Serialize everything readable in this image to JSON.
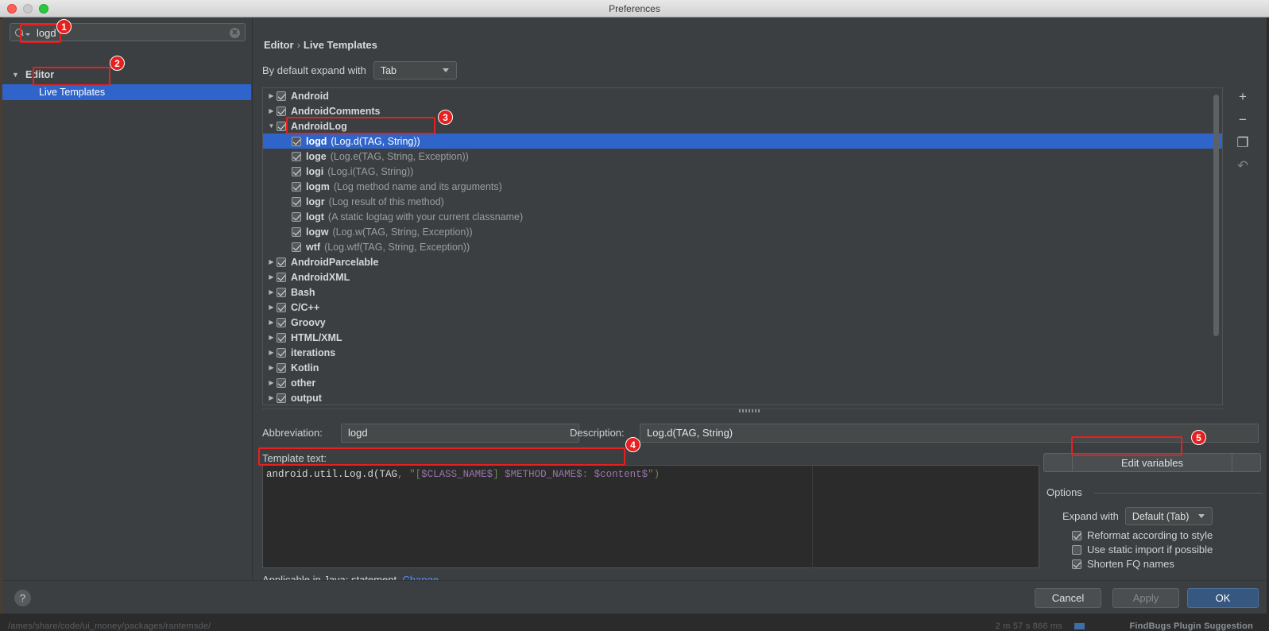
{
  "window": {
    "title": "Preferences",
    "controls": [
      "close",
      "minimize",
      "zoom"
    ]
  },
  "sidebar": {
    "search": {
      "value": "logd",
      "placeholder": ""
    },
    "tree": [
      {
        "label": "Editor",
        "expanded": true,
        "selected": false
      },
      {
        "label": "Live Templates",
        "expanded": false,
        "selected": true
      }
    ]
  },
  "breadcrumb": {
    "root": "Editor",
    "separator": "›",
    "leaf": "Live Templates"
  },
  "expand_with": {
    "label": "By default expand with",
    "value": "Tab"
  },
  "templates": [
    {
      "indent": 0,
      "arrow": "▶",
      "checked": true,
      "name": "Android",
      "desc": "",
      "selected": false
    },
    {
      "indent": 0,
      "arrow": "▶",
      "checked": true,
      "name": "AndroidComments",
      "desc": "",
      "selected": false
    },
    {
      "indent": 0,
      "arrow": "▼",
      "checked": true,
      "name": "AndroidLog",
      "desc": "",
      "selected": false
    },
    {
      "indent": 1,
      "arrow": "",
      "checked": true,
      "name": "logd",
      "desc": "(Log.d(TAG, String))",
      "selected": true
    },
    {
      "indent": 1,
      "arrow": "",
      "checked": true,
      "name": "loge",
      "desc": "(Log.e(TAG, String, Exception))",
      "selected": false
    },
    {
      "indent": 1,
      "arrow": "",
      "checked": true,
      "name": "logi",
      "desc": "(Log.i(TAG, String))",
      "selected": false
    },
    {
      "indent": 1,
      "arrow": "",
      "checked": true,
      "name": "logm",
      "desc": "(Log method name and its arguments)",
      "selected": false
    },
    {
      "indent": 1,
      "arrow": "",
      "checked": true,
      "name": "logr",
      "desc": "(Log result of this method)",
      "selected": false
    },
    {
      "indent": 1,
      "arrow": "",
      "checked": true,
      "name": "logt",
      "desc": "(A static logtag with your current classname)",
      "selected": false
    },
    {
      "indent": 1,
      "arrow": "",
      "checked": true,
      "name": "logw",
      "desc": "(Log.w(TAG, String, Exception))",
      "selected": false
    },
    {
      "indent": 1,
      "arrow": "",
      "checked": true,
      "name": "wtf",
      "desc": "(Log.wtf(TAG, String, Exception))",
      "selected": false
    },
    {
      "indent": 0,
      "arrow": "▶",
      "checked": true,
      "name": "AndroidParcelable",
      "desc": "",
      "selected": false
    },
    {
      "indent": 0,
      "arrow": "▶",
      "checked": true,
      "name": "AndroidXML",
      "desc": "",
      "selected": false
    },
    {
      "indent": 0,
      "arrow": "▶",
      "checked": true,
      "name": "Bash",
      "desc": "",
      "selected": false
    },
    {
      "indent": 0,
      "arrow": "▶",
      "checked": true,
      "name": "C/C++",
      "desc": "",
      "selected": false
    },
    {
      "indent": 0,
      "arrow": "▶",
      "checked": true,
      "name": "Groovy",
      "desc": "",
      "selected": false
    },
    {
      "indent": 0,
      "arrow": "▶",
      "checked": true,
      "name": "HTML/XML",
      "desc": "",
      "selected": false
    },
    {
      "indent": 0,
      "arrow": "▶",
      "checked": true,
      "name": "iterations",
      "desc": "",
      "selected": false
    },
    {
      "indent": 0,
      "arrow": "▶",
      "checked": true,
      "name": "Kotlin",
      "desc": "",
      "selected": false
    },
    {
      "indent": 0,
      "arrow": "▶",
      "checked": true,
      "name": "other",
      "desc": "",
      "selected": false
    },
    {
      "indent": 0,
      "arrow": "▶",
      "checked": true,
      "name": "output",
      "desc": "",
      "selected": false
    }
  ],
  "list_tools": [
    {
      "icon": "plus-icon",
      "glyph": "+",
      "enabled": true
    },
    {
      "icon": "minus-icon",
      "glyph": "−",
      "enabled": true
    },
    {
      "icon": "copy-icon",
      "glyph": "❐",
      "enabled": true
    },
    {
      "icon": "undo-icon",
      "glyph": "↶",
      "enabled": false
    }
  ],
  "fields": {
    "abbreviation_label": "Abbreviation:",
    "abbreviation_value": "logd",
    "description_label": "Description:",
    "description_value": "Log.d(TAG, String)"
  },
  "template_text": {
    "label": "Template text:",
    "segments": [
      {
        "text": "android.util.Log.d(TAG",
        "style": "plain"
      },
      {
        "text": ",",
        "style": "comma"
      },
      {
        "text": " ",
        "style": "plain"
      },
      {
        "text": "\"[",
        "style": "str"
      },
      {
        "text": "$CLASS_NAME$",
        "style": "var"
      },
      {
        "text": "] ",
        "style": "str"
      },
      {
        "text": "$METHOD_NAME$",
        "style": "var"
      },
      {
        "text": ": ",
        "style": "str"
      },
      {
        "text": "$content$",
        "style": "var"
      },
      {
        "text": "\")",
        "style": "str"
      }
    ],
    "full": "android.util.Log.d(TAG, \"[$CLASS_NAME$] $METHOD_NAME$: $content$\")"
  },
  "applicable": {
    "text": "Applicable in Java: statement.",
    "link": "Change"
  },
  "options": {
    "edit_variables_label": "Edit variables",
    "legend": "Options",
    "expand_with_label": "Expand with",
    "expand_with_value": "Default (Tab)",
    "checkboxes": [
      {
        "label": "Reformat according to style",
        "checked": true
      },
      {
        "label": "Use static import if possible",
        "checked": false
      },
      {
        "label": "Shorten FQ names",
        "checked": true
      }
    ]
  },
  "footer": {
    "help": "?",
    "cancel": "Cancel",
    "apply": "Apply",
    "ok": "OK"
  },
  "annotations": [
    {
      "n": "1",
      "target": "search-field"
    },
    {
      "n": "2",
      "target": "live-templates-node"
    },
    {
      "n": "3",
      "target": "logd-row"
    },
    {
      "n": "4",
      "target": "template-text-line"
    },
    {
      "n": "5",
      "target": "edit-variables-button"
    }
  ],
  "background": {
    "path_text": "/ames/share/code/ui_money/packages/rantemsde/",
    "time_text": "2 m 57 s 866 ms",
    "plugin_text": "FindBugs Plugin Suggestion"
  },
  "colors": {
    "accent_selection": "#2f65ca",
    "annotation_red": "#e81f1f",
    "ok_button": "#365880",
    "link_blue": "#548af7",
    "code_string": "#6a8759",
    "code_variable": "#9876aa",
    "code_comma": "#cc7832"
  }
}
